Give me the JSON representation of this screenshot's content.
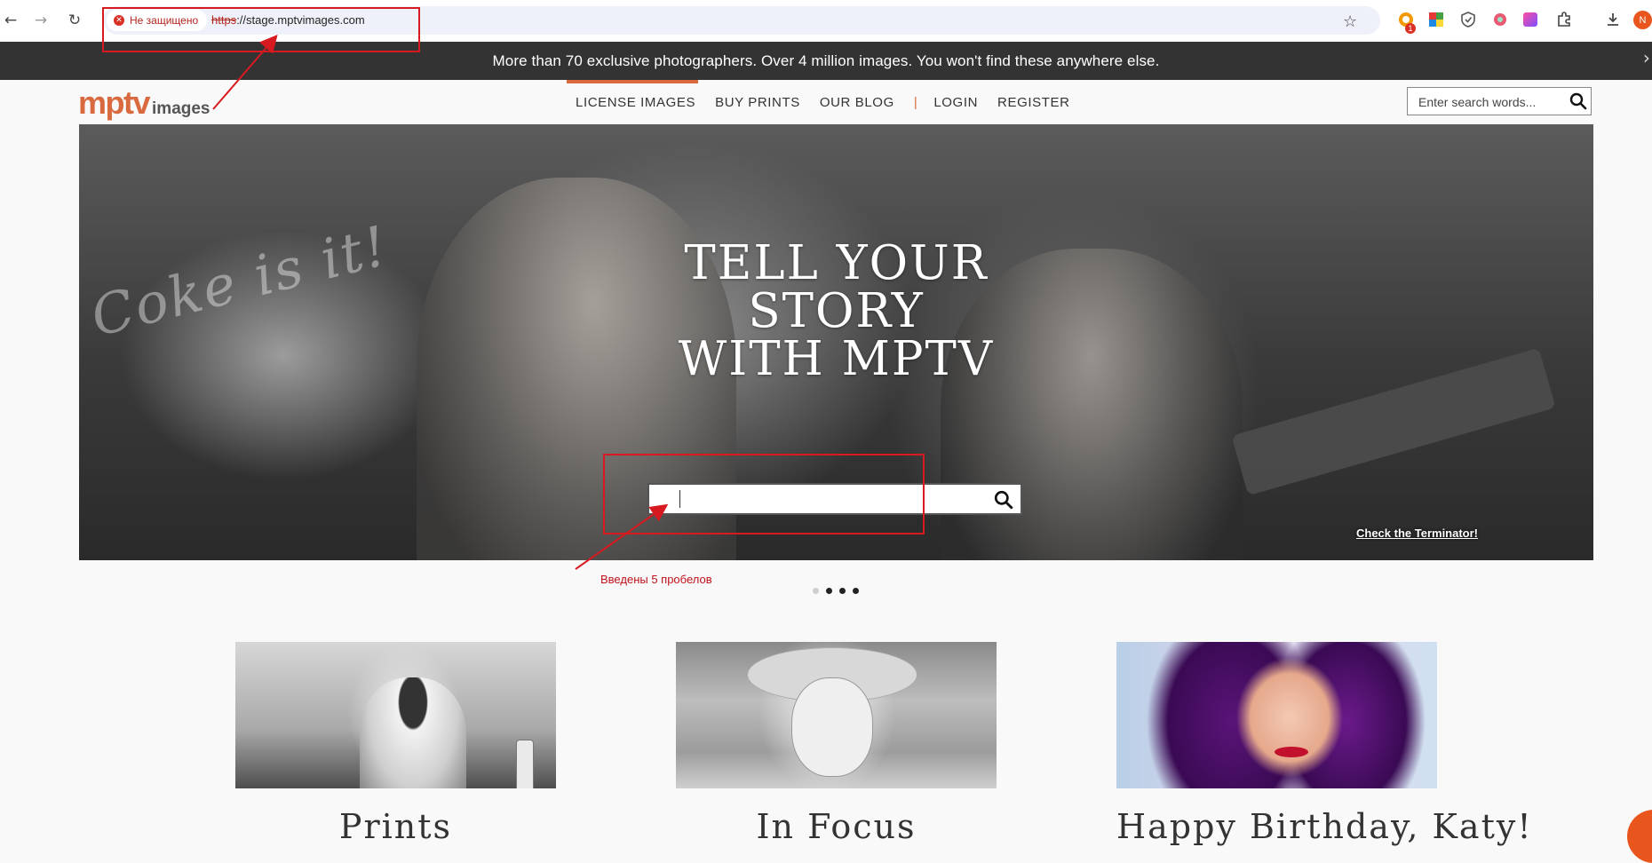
{
  "browser": {
    "back_icon": "←",
    "forward_icon": "→",
    "reload_icon": "↻",
    "security_label": "Не защищено",
    "url_scheme": "https",
    "url_rest": "://stage.mptvimages.com",
    "bookmark_icon": "☆",
    "extension_badge_count": "1",
    "profile_initial": "N",
    "extension_icons": [
      "extension-icon",
      "color-picker-icon",
      "shield-icon",
      "rocket-icon",
      "gradient-icon",
      "puzzle-icon",
      "download-icon"
    ]
  },
  "banner": {
    "text": "More than 70 exclusive photographers. Over 4 million images. You won't find these anywhere else."
  },
  "header": {
    "logo_main": "mptv",
    "logo_sub": "images",
    "nav": [
      "LICENSE IMAGES",
      "BUY PRINTS",
      "OUR BLOG",
      "LOGIN",
      "REGISTER"
    ],
    "nav_separator": "|",
    "search_placeholder": "Enter search words..."
  },
  "hero": {
    "title_lines": [
      "TELL YOUR",
      "STORY",
      "WITH MPTV"
    ],
    "search_value": "     ",
    "caption": "Check the Terminator!",
    "slides_total": 4,
    "active_slide": 1,
    "neon_sign": "Coke is it!"
  },
  "annotation": {
    "note": "Введены 5 пробелов",
    "color": "#d71920"
  },
  "cards": [
    {
      "title": "Prints"
    },
    {
      "title": "In Focus"
    },
    {
      "title": "Happy Birthday, Katy!"
    }
  ],
  "colors": {
    "accent": "#d96a3f",
    "banner_bg": "#333333",
    "page_bg": "#f9f9f9"
  }
}
